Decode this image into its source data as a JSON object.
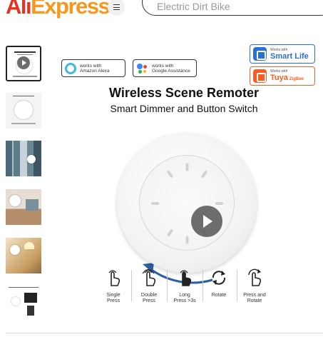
{
  "header": {
    "logo_part1": "Ali",
    "logo_part2": "Express",
    "search_value": "Electric Dirt Bike"
  },
  "gallery": {
    "thumbnail_count": 6,
    "active_index": 0
  },
  "main_image": {
    "alexa_badge_line1": "works with",
    "alexa_badge_line2": "Amazon Alexa",
    "google_badge_line1": "works with",
    "google_badge_line2": "Google Assistance",
    "smartlife_small": "Works with",
    "smartlife_big": "Smart Life",
    "tuya_small": "Works with",
    "tuya_big": "Tuya",
    "tuya_zigbee": "ZigBee",
    "title": "Wireless Scene Remoter",
    "subtitle": "Smart Dimmer and Button Switch",
    "gestures": [
      {
        "line1": "Single",
        "line2": "Press"
      },
      {
        "line1": "Double",
        "line2": "Press"
      },
      {
        "line1": "Long",
        "line2": "Press >3s"
      },
      {
        "line1": "Rotate",
        "line2": ""
      },
      {
        "line1": "Press and",
        "line2": "Rotate"
      }
    ]
  },
  "colors": {
    "brand_red": "#e43225",
    "brand_orange": "#f7971d",
    "arrow_blue": "#2a5fa8",
    "smartlife_blue": "#2a6fd6",
    "tuya_orange": "#ff5a1f"
  },
  "icons": {
    "menu": "hamburger-icon",
    "play": "play-icon",
    "rotation": "rotate-arrows-icon"
  }
}
